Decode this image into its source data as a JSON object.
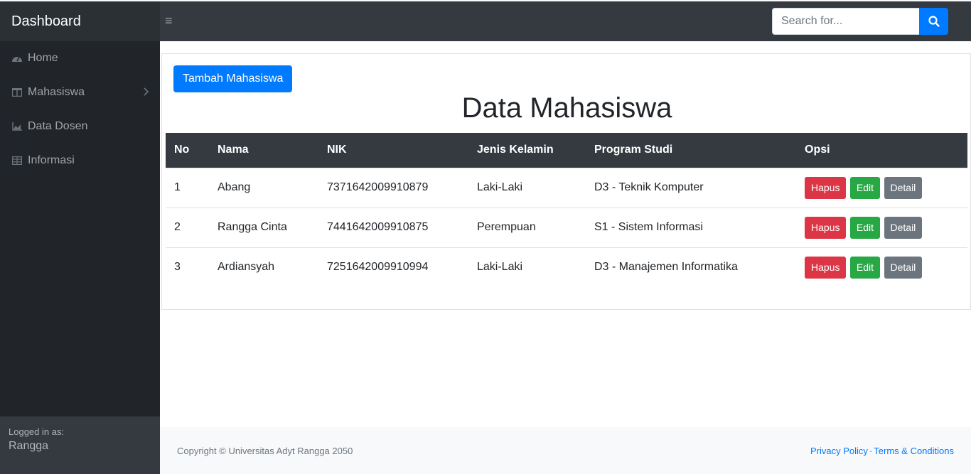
{
  "app": {
    "brand": "Dashboard"
  },
  "search": {
    "placeholder": "Search for..."
  },
  "sidebar": {
    "items": [
      {
        "label": "Home",
        "icon": "tachometer-icon"
      },
      {
        "label": "Mahasiswa",
        "icon": "columns-icon"
      },
      {
        "label": "Data Dosen",
        "icon": "area-chart-icon"
      },
      {
        "label": "Informasi",
        "icon": "table-icon"
      }
    ],
    "footer": {
      "logged_in_label": "Logged in as:",
      "user": "Rangga"
    }
  },
  "main": {
    "add_button": "Tambah Mahasiswa",
    "title": "Data Mahasiswa",
    "table": {
      "headers": [
        "No",
        "Nama",
        "NIK",
        "Jenis Kelamin",
        "Program Studi",
        "Opsi"
      ],
      "rows": [
        {
          "no": "1",
          "nama": "Abang",
          "nik": "7371642009910879",
          "jk": "Laki-Laki",
          "prodi": "D3 - Teknik Komputer"
        },
        {
          "no": "2",
          "nama": "Rangga Cinta",
          "nik": "7441642009910875",
          "jk": "Perempuan",
          "prodi": "S1 - Sistem Informasi"
        },
        {
          "no": "3",
          "nama": "Ardiansyah",
          "nik": "7251642009910994",
          "jk": "Laki-Laki",
          "prodi": "D3 - Manajemen Informatika"
        }
      ],
      "actions": {
        "delete": "Hapus",
        "edit": "Edit",
        "detail": "Detail"
      }
    }
  },
  "footer": {
    "copyright": "Copyright © Universitas Adyt Rangga 2050",
    "privacy": "Privacy Policy",
    "separator": "·",
    "terms": "Terms & Conditions"
  },
  "colors": {
    "primary": "#007bff",
    "danger": "#dc3545",
    "success": "#28a745",
    "secondary": "#6c757d",
    "dark": "#343a40"
  }
}
